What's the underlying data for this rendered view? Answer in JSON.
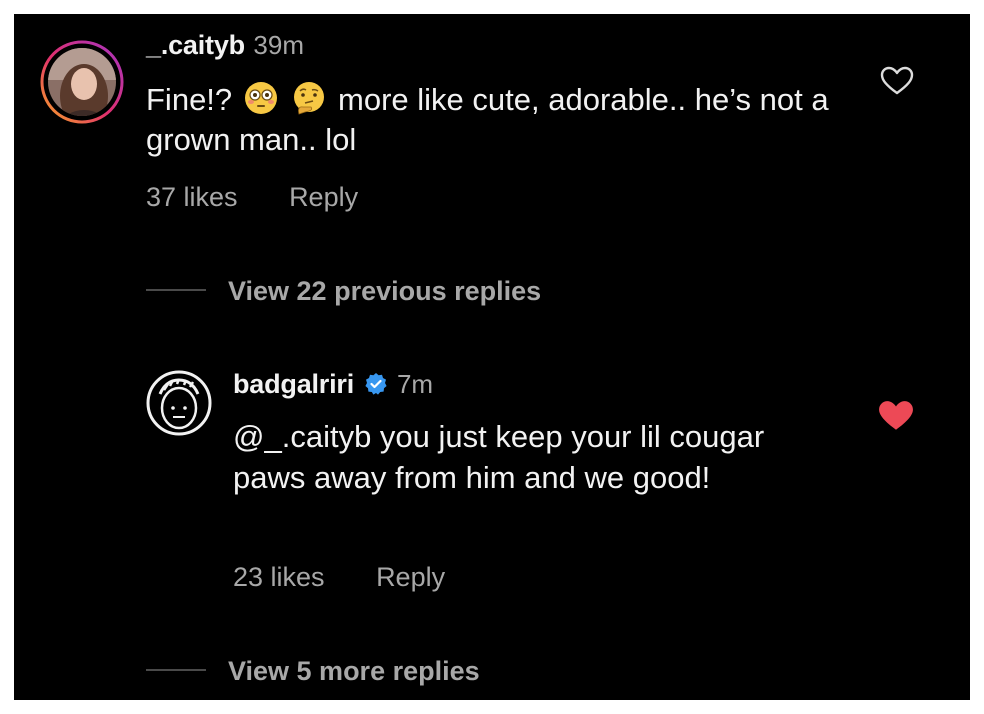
{
  "comments": [
    {
      "username": "_.caityb",
      "time": "39m",
      "text_before": "Fine!?",
      "emojis": [
        "flushed-face",
        "thinking-face"
      ],
      "text_after": "more like cute, adorable.. he’s not a grown man.. lol",
      "likes": "37 likes",
      "reply": "Reply",
      "liked": false
    }
  ],
  "view_previous": "View 22 previous replies",
  "reply": {
    "username": "badgalriri",
    "verified": true,
    "time": "7m",
    "text": "@_.caityb you just keep your lil cougar paws away from him and we good!",
    "likes": "23 likes",
    "reply": "Reply",
    "liked": true
  },
  "view_more": "View 5 more replies",
  "colors": {
    "background": "#000000",
    "primary_text": "#f2f2f2",
    "secondary_text": "#a8a8a8",
    "like_red": "#ed4956",
    "verified_blue": "#3897f0"
  }
}
